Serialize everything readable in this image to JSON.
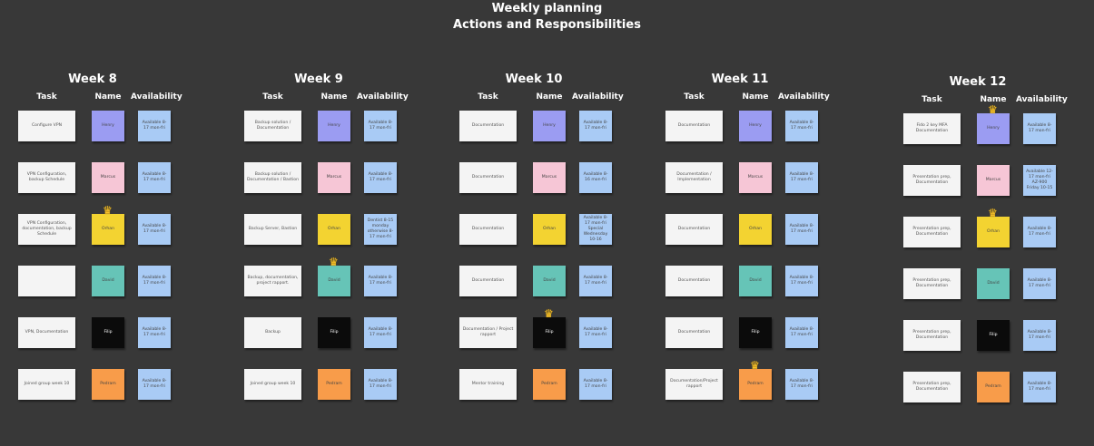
{
  "title": {
    "line1": "Weekly planning",
    "line2": "Actions and Responsibilities"
  },
  "headers": {
    "task": "Task",
    "name": "Name",
    "availability": "Availability"
  },
  "colors": {
    "background": "#383838",
    "Henry": "#9b9cf2",
    "Marcus": "#f6c6d6",
    "Orhan": "#f3d331",
    "David": "#66c4b7",
    "Filip": "#0b0b0b",
    "Pedram": "#f89c4a",
    "task": "#f4f4f4",
    "availability": "#a9cbf5",
    "crown": "#f6c02a"
  },
  "crown_icon": "crown-icon",
  "weeks": [
    {
      "title": "Week 8",
      "rows": [
        {
          "task": "Configure VPN",
          "name": "Henry",
          "availability": "Available 8-17 mon-fri"
        },
        {
          "task": "VPN Configuration, backup Schedule",
          "name": "Marcus",
          "availability": "Available 8-17 mon-fri"
        },
        {
          "task": "VPN Configuration, documentation, backup Schedule",
          "name": "Orhan",
          "availability": "Available 8-17 mon-fri",
          "crown": true
        },
        {
          "task": "",
          "name": "David",
          "availability": "Available 8-17 mon-fri"
        },
        {
          "task": "VPN, Documentation",
          "name": "Filip",
          "availability": "Available 8-17 mon-fri"
        },
        {
          "task": "Joined group week 10",
          "name": "Pedram",
          "availability": "Available 8-17 mon-fri"
        }
      ]
    },
    {
      "title": "Week 9",
      "rows": [
        {
          "task": "Backup solution / Documentation",
          "name": "Henry",
          "availability": "Available 8-17 mon-fri"
        },
        {
          "task": "Backup solution / Documentation / Bastion",
          "name": "Marcus",
          "availability": "Available 8-17 mon-fri"
        },
        {
          "task": "Backup Server, Bastion",
          "name": "Orhan",
          "availability": "Dentist 8-15 monday otherwise 8-17 mon-fri"
        },
        {
          "task": "Backup, documentation, project rapport.",
          "name": "David",
          "availability": "Available 8-17 mon-fri",
          "crown": true
        },
        {
          "task": "Backup",
          "name": "Filip",
          "availability": "Available 8-17 mon-fri"
        },
        {
          "task": "Joined group week 10",
          "name": "Pedram",
          "availability": "Available 8-17 mon-fri"
        }
      ]
    },
    {
      "title": "Week 10",
      "rows": [
        {
          "task": "Documentation",
          "name": "Henry",
          "availability": "Available 8-17 mon-fri"
        },
        {
          "task": "Documentation",
          "name": "Marcus",
          "availability": "Available 8-16 mon-fri"
        },
        {
          "task": "Documentation",
          "name": "Orhan",
          "availability": "Available 8-17 mon-fri Special Wednesday 10-16"
        },
        {
          "task": "Documentation",
          "name": "David",
          "availability": "Available 8-17 mon-fri"
        },
        {
          "task": "Documentation / Project rapport",
          "name": "Filip",
          "availability": "Available 8-17 mon-fri",
          "crown": true
        },
        {
          "task": "Mentor training",
          "name": "Pedram",
          "availability": "Available 8-17 mon-fri"
        }
      ]
    },
    {
      "title": "Week 11",
      "rows": [
        {
          "task": "Documentation",
          "name": "Henry",
          "availability": "Available 8-17 mon-fri"
        },
        {
          "task": "Documentation / Implementation",
          "name": "Marcus",
          "availability": "Available 8-17 mon-fri"
        },
        {
          "task": "Documentation",
          "name": "Orhan",
          "availability": "Available 8-17 mon-fri"
        },
        {
          "task": "Documentation",
          "name": "David",
          "availability": "Available 8-17 mon-fri"
        },
        {
          "task": "Documentation",
          "name": "Filip",
          "availability": "Available 8-17 mon-fri"
        },
        {
          "task": "Documentation/Project rapport",
          "name": "Pedram",
          "availability": "Available 8-17 mon-fri",
          "crown": true
        }
      ]
    },
    {
      "title": "Week 12",
      "rows": [
        {
          "task": "Fido 2 key MFA Documentation",
          "name": "Henry",
          "availability": "Available 8-17 mon-fri",
          "crown": true
        },
        {
          "task": "Presentation prep, Documentation",
          "name": "Marcus",
          "availability": "Available 12-17 mon-fri AZ-900 Friday 10-15"
        },
        {
          "task": "Presentation prep, Documentation",
          "name": "Orhan",
          "availability": "Available 8-17 mon-fri",
          "crown": true
        },
        {
          "task": "Presentation prep, Documentation",
          "name": "David",
          "availability": "Available 8-17 mon-fri"
        },
        {
          "task": "Presentation prep, Documentation",
          "name": "Filip",
          "availability": "Available 8-17 mon-fri"
        },
        {
          "task": "Presentation prep, Documentation",
          "name": "Pedram",
          "availability": "Available 8-17 mon-fri"
        }
      ]
    }
  ]
}
